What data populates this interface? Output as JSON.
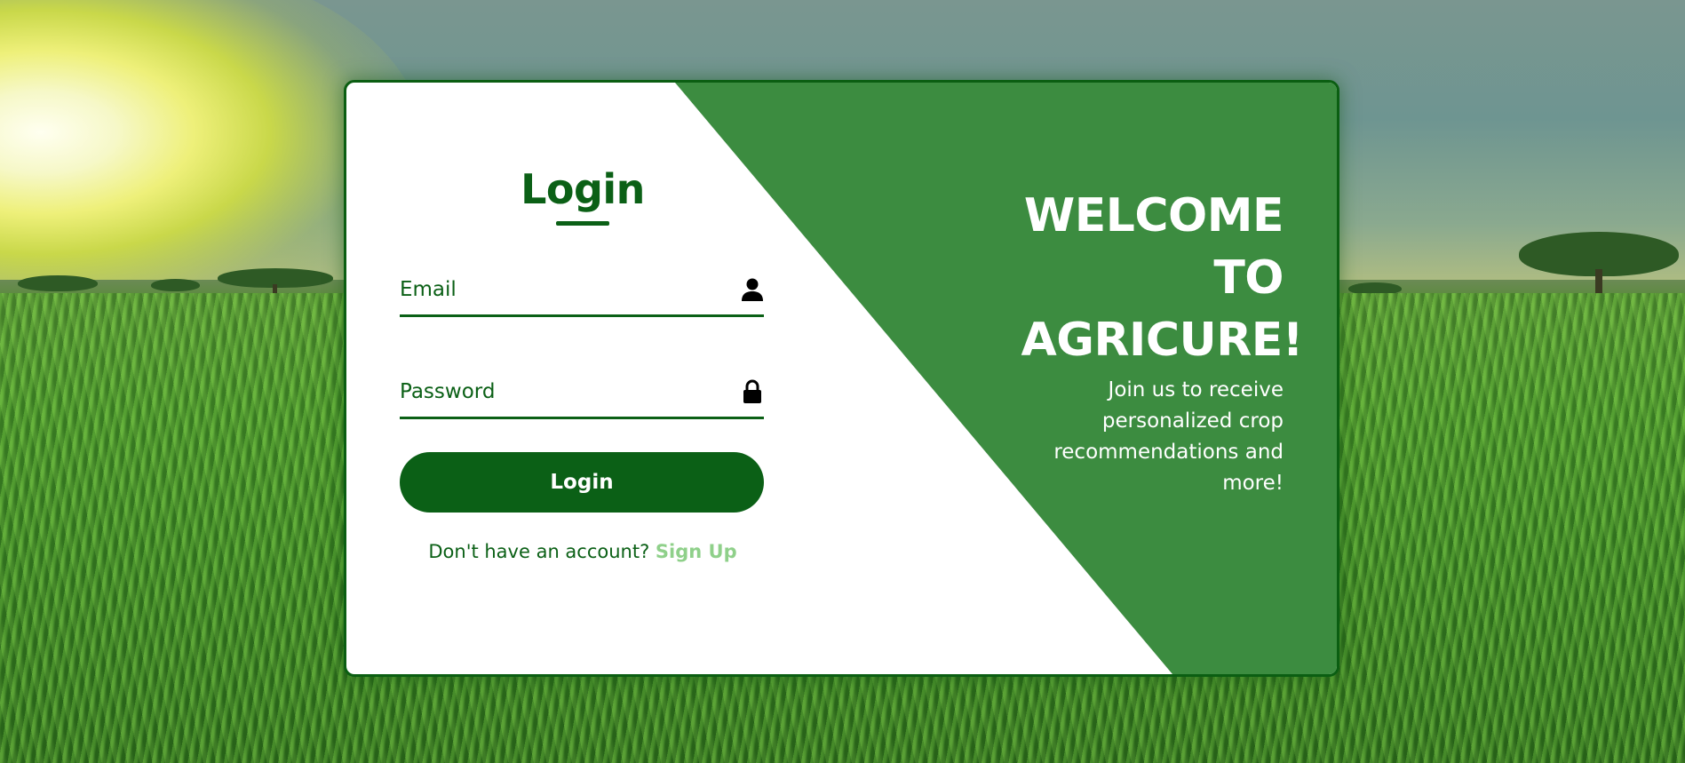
{
  "login": {
    "title": "Login",
    "email_placeholder": "Email",
    "password_placeholder": "Password",
    "button_label": "Login",
    "signup_prompt": "Don't have an account?",
    "signup_link": "Sign Up"
  },
  "welcome": {
    "line1": "WELCOME",
    "line2": "TO",
    "line3": "AGRICURE!",
    "text": "Join us to receive personalized crop recommendations and more!"
  },
  "colors": {
    "primary_green": "#0b6016",
    "panel_green": "#3c8c40",
    "link_green": "#8fd08a",
    "card_background": "#ffffff"
  },
  "icons": {
    "email": "user-icon",
    "password": "lock-icon"
  }
}
